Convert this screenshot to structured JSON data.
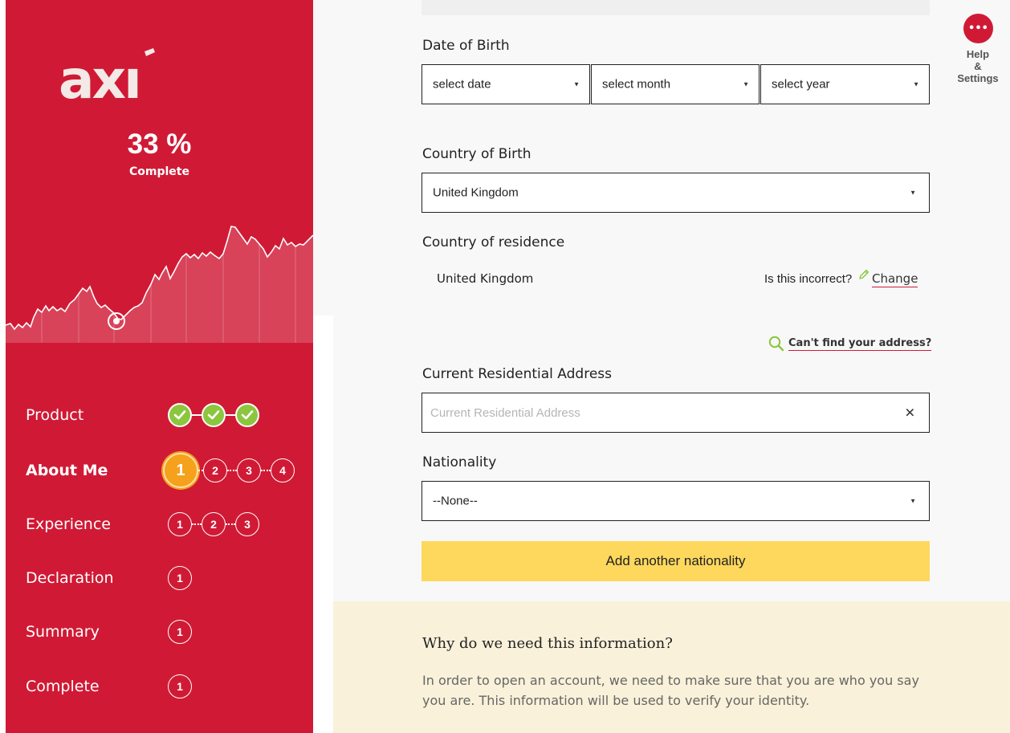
{
  "brand": {
    "logo_text": "axi",
    "accent": "#d01a35",
    "success": "#8cc63f",
    "current": "#f5a11c",
    "button": "#fdd85d"
  },
  "progress": {
    "percent": "33 %",
    "label": "Complete",
    "value": 0.33
  },
  "steps": [
    {
      "label": "Product",
      "state": "done",
      "dots": [
        "",
        "",
        ""
      ]
    },
    {
      "label": "About Me",
      "state": "active",
      "dots": [
        "1",
        "2",
        "3",
        "4"
      ]
    },
    {
      "label": "Experience",
      "state": "pending",
      "dots": [
        "1",
        "2",
        "3"
      ]
    },
    {
      "label": "Declaration",
      "state": "pending",
      "dots": [
        "1"
      ]
    },
    {
      "label": "Summary",
      "state": "pending",
      "dots": [
        "1"
      ]
    },
    {
      "label": "Complete",
      "state": "pending",
      "dots": [
        "1"
      ]
    }
  ],
  "help": {
    "icon": "more-dots-icon",
    "glyph": "•••",
    "line1": "Help",
    "line2": "&",
    "line3": "Settings"
  },
  "form": {
    "dob": {
      "label": "Date of Birth",
      "date": "select date",
      "month": "select month",
      "year": "select year"
    },
    "country_of_birth": {
      "label": "Country of Birth",
      "value": "United Kingdom"
    },
    "residence": {
      "label": "Country of residence",
      "value": "United Kingdom",
      "question": "Is this incorrect?",
      "change": "Change"
    },
    "cant_find": "Can't find your address?",
    "address": {
      "label": "Current Residential Address",
      "placeholder": "Current Residential Address",
      "clear": "✕"
    },
    "nationality": {
      "label": "Nationality",
      "value": "--None--"
    },
    "add_nationality": "Add another nationality"
  },
  "info": {
    "title": "Why do we need this information?",
    "text": "In order to open an account, we need to make sure that you are who you say you are. This information will be used to verify your identity."
  }
}
